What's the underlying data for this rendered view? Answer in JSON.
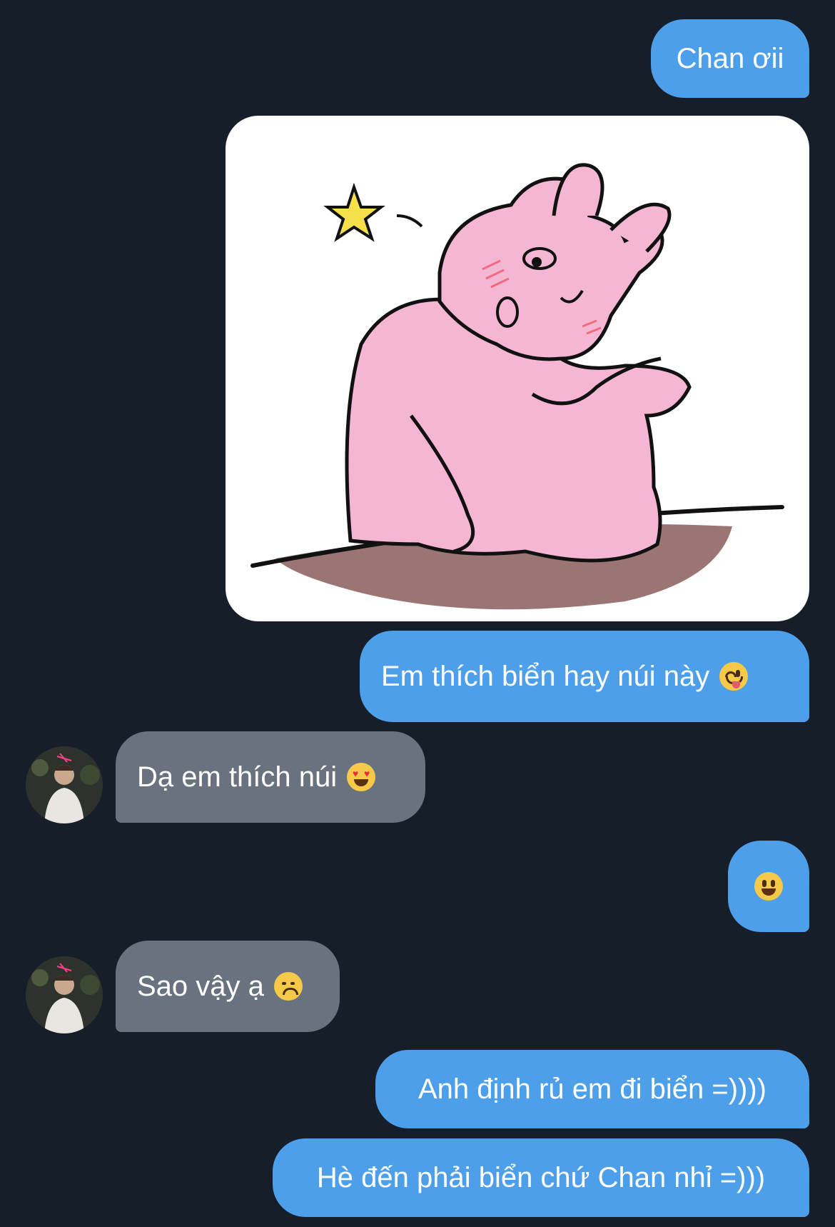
{
  "messages": [
    {
      "text": "Chan ơii"
    },
    {
      "text": ""
    },
    {
      "text": "Em thích biển hay núi này",
      "emoji": "yum-emoji"
    },
    {
      "text": "Dạ em thích núi",
      "emoji": "heart-eyes-emoji"
    },
    {
      "text": "",
      "emoji": "grinning-emoji"
    },
    {
      "text": "Sao vậy ạ",
      "emoji": "disappointed-emoji"
    },
    {
      "text": "Anh định rủ em đi biển =))))"
    },
    {
      "text": "Hè đến phải biển chứ Chan nhỉ =)))"
    }
  ],
  "colors": {
    "background": "#161e29",
    "outgoing_bubble": "#4e9fe9",
    "incoming_bubble": "#69737f",
    "text": "#ffffff"
  }
}
